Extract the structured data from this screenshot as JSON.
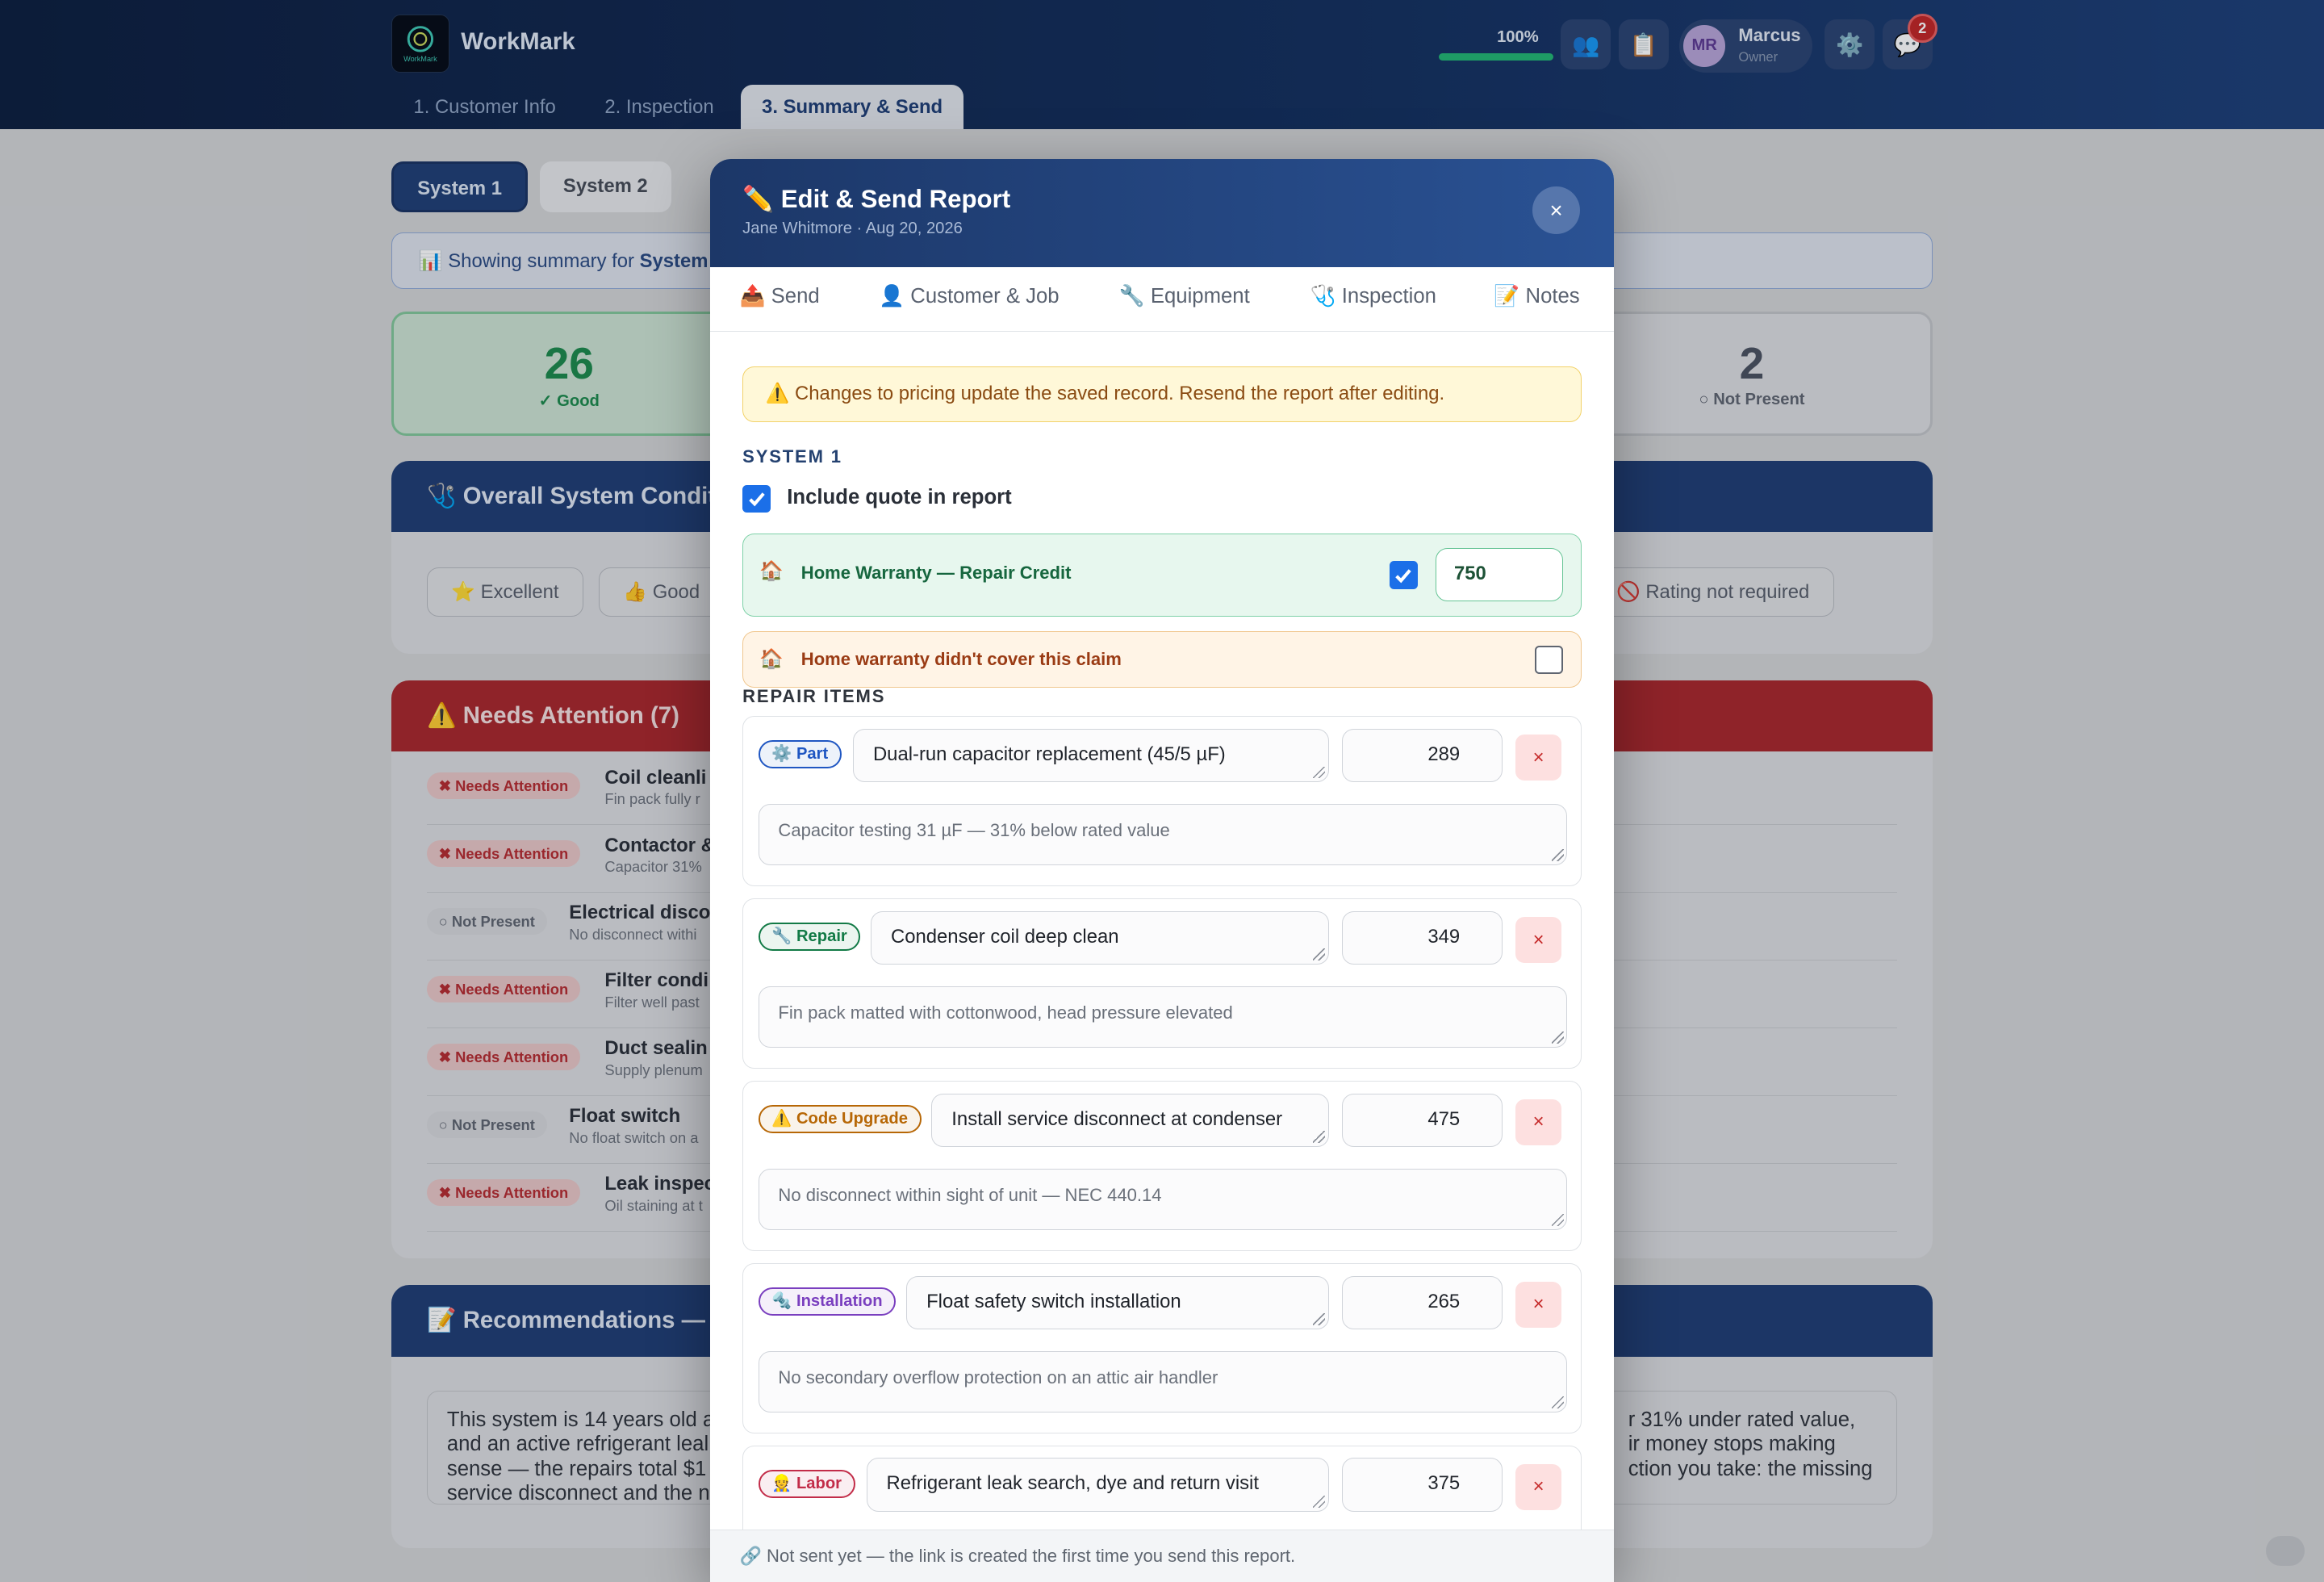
{
  "app": {
    "brand": "WorkMark",
    "logo_text": "WorkMark",
    "tabs": [
      {
        "label": "1. Customer Info"
      },
      {
        "label": "2. Inspection"
      },
      {
        "label": "3. Summary & Send",
        "active": true
      }
    ],
    "progress": {
      "label": "100%",
      "value": 1.0
    },
    "user": {
      "initials": "MR",
      "name": "Marcus",
      "role": "Owner"
    },
    "notifications_count": "2",
    "icons": [
      "users-icon",
      "clipboard-icon",
      "gear-icon",
      "chat-icon"
    ]
  },
  "page": {
    "systems": [
      "System 1",
      "System 2"
    ],
    "info_prefix": "📊 Showing summary for ",
    "info_system": "System",
    "stats": [
      {
        "value": "26",
        "label": "✓ Good"
      },
      {
        "value": "2",
        "label": "○ Not Present"
      }
    ],
    "overall_title": "🩺 Overall System Conditio",
    "ratings": [
      "⭐ Excellent",
      "👍 Good",
      "🚫 Rating not required"
    ],
    "attention_title": "⚠️ Needs Attention (7)",
    "attention_rows": [
      {
        "status": "✖ Needs Attention",
        "kind": "na",
        "title": "Coil cleanli",
        "sub": "Fin pack fully r"
      },
      {
        "status": "✖ Needs Attention",
        "kind": "na",
        "title": "Contactor &",
        "sub": "Capacitor 31%"
      },
      {
        "status": "○ Not Present",
        "kind": "np",
        "title": "Electrical disco",
        "sub": "No disconnect withi"
      },
      {
        "status": "✖ Needs Attention",
        "kind": "na",
        "title": "Filter condi",
        "sub": "Filter well past"
      },
      {
        "status": "✖ Needs Attention",
        "kind": "na",
        "title": "Duct sealin",
        "sub": "Supply plenum"
      },
      {
        "status": "○ Not Present",
        "kind": "np",
        "title": "Float switch",
        "sub": "No float switch on a"
      },
      {
        "status": "✖ Needs Attention",
        "kind": "na",
        "title": "Leak inspec",
        "sub": "Oil staining at t"
      }
    ],
    "recommend_title": "📝 Recommendations — Sy",
    "rec_left": "This system is 14 years old a\nand an active refrigerant leal\nsense — the repairs total $1\nservice disconnect and the n",
    "rec_right": "r 31% under rated value,\nir money stops making\nction you take: the missing"
  },
  "modal": {
    "title": "✏️ Edit & Send Report",
    "subtitle": "Jane Whitmore · Aug 20, 2026",
    "close": "×",
    "tabs": [
      "📤 Send",
      "👤 Customer & Job",
      "🔧 Equipment",
      "🩺 Inspection",
      "📝 Notes"
    ],
    "warning": "⚠️ Changes to pricing update the saved record. Resend the report after editing.",
    "system_label": "SYSTEM 1",
    "include_quote": {
      "label": "Include quote in report",
      "checked": true
    },
    "home_warranty": {
      "label": "Home Warranty — Repair Credit",
      "checked": true,
      "amount": "750",
      "icon": "🏠"
    },
    "warranty_denied": {
      "label": "Home warranty didn't cover this claim",
      "checked": false,
      "icon": "🏠"
    },
    "repair_label": "REPAIR ITEMS",
    "items": [
      {
        "category": "⚙️ Part",
        "cat_color": "#1f56c2",
        "description": "Dual-run capacitor replacement (45/5 µF)",
        "price": "289",
        "note": "Capacitor testing 31 µF — 31% below rated value"
      },
      {
        "category": "🔧 Repair",
        "cat_color": "#127a46",
        "description": "Condenser coil deep clean",
        "price": "349",
        "note": "Fin pack matted with cottonwood, head pressure elevated"
      },
      {
        "category": "⚠️ Code Upgrade",
        "cat_color": "#b76706",
        "description": "Install service disconnect at condenser",
        "price": "475",
        "note": "No disconnect within sight of unit — NEC 440.14"
      },
      {
        "category": "🔩 Installation",
        "cat_color": "#7a3fbf",
        "description": "Float safety switch installation",
        "price": "265",
        "note": "No secondary overflow protection on an attic air handler"
      },
      {
        "category": "👷 Labor",
        "cat_color": "#c22c48",
        "description": "Refrigerant leak search, dye and return visit",
        "price": "375",
        "note": ""
      }
    ],
    "footer": "🔗 Not sent yet — the link is created the first time you send this report."
  }
}
